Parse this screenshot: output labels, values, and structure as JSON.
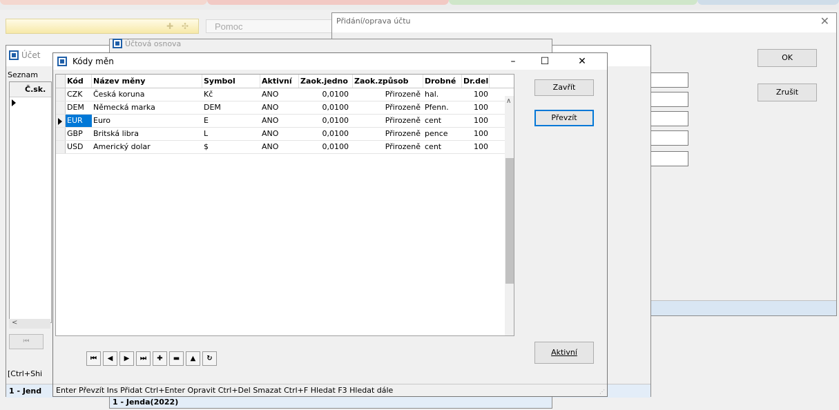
{
  "app": {
    "help_label": "Pomoc"
  },
  "pridani": {
    "title": "Přidání/oprava účtu",
    "ok_label": "OK",
    "cancel_label": "Zrušit"
  },
  "ucetni": {
    "title": "Účet",
    "tab_label": "Seznam",
    "column_header": "Č.sk.",
    "shortcut_hint": "[Ctrl+Shi",
    "status_user": "1 - Jend"
  },
  "osnova": {
    "title": "Účtová osnova",
    "status_user": "1 - Jenda(2022)"
  },
  "kody": {
    "title": "Kódy měn",
    "columns": [
      "Kód",
      "Název měny",
      "Symbol",
      "Aktivní",
      "Zaok.jedno",
      "Zaok.způsob",
      "Drobné",
      "Dr.delit"
    ],
    "rows": [
      [
        "CZK",
        "Česká koruna",
        "Kč",
        "ANO",
        "0,0100",
        "Přirozeně",
        "hal.",
        "100"
      ],
      [
        "DEM",
        "Německá marka",
        "DEM",
        "ANO",
        "0,0100",
        "Přirozeně",
        "Pfenn.",
        "100"
      ],
      [
        "EUR",
        "Euro",
        "E",
        "ANO",
        "0,0100",
        "Přirozeně",
        "cent",
        "100"
      ],
      [
        "GBP",
        "Britská libra",
        "L",
        "ANO",
        "0,0100",
        "Přirozeně",
        "pence",
        "100"
      ],
      [
        "USD",
        "Americký dolar",
        "$",
        "ANO",
        "0,0100",
        "Přirozeně",
        "cent",
        "100"
      ]
    ],
    "selected_row": 2,
    "close_label": "Zavřít",
    "take_label": "Převzít",
    "active_label": "Aktivní",
    "status_bar": "Enter Převzít   Ins Přidat   Ctrl+Enter Opravit   Ctrl+Del Smazat   Ctrl+F Hledat   F3 Hledat dále"
  },
  "icons": {
    "nav_first": "⏮",
    "nav_prev": "◀",
    "nav_next": "▶",
    "nav_last": "⏭",
    "nav_add": "✚",
    "nav_delete": "▬",
    "nav_post": "▲",
    "nav_refresh": "↻"
  },
  "colors": {
    "selection": "#0078d7",
    "status_bar": "#e3edf8"
  }
}
